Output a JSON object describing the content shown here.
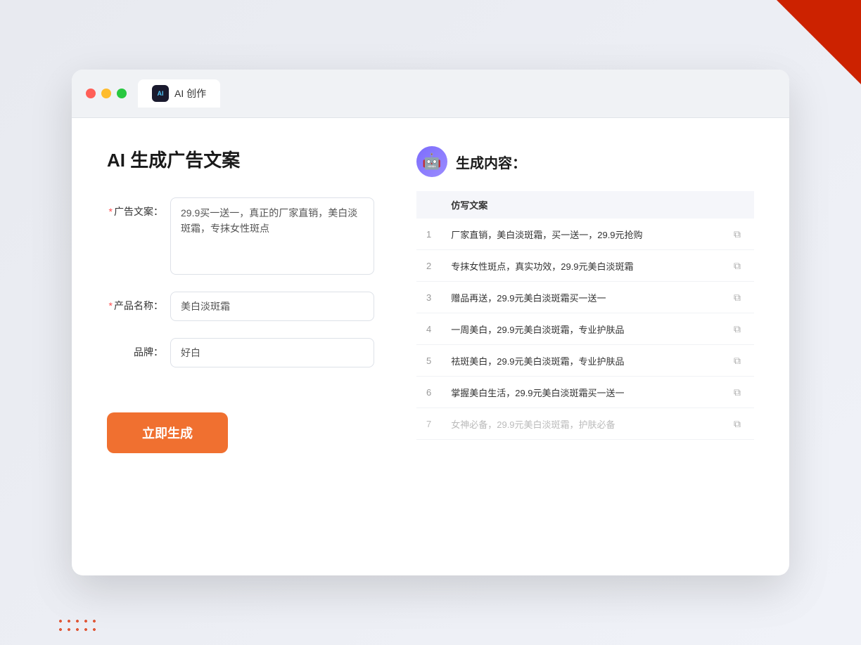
{
  "window": {
    "tab_label": "AI 创作",
    "controls": {
      "close": "close",
      "minimize": "minimize",
      "maximize": "maximize"
    }
  },
  "page": {
    "title": "AI 生成广告文案",
    "form": {
      "ad_copy_label": "广告文案：",
      "ad_copy_required": "*",
      "ad_copy_value": "29.9买一送一，真正的厂家直销，美白淡斑霜，专抹女性斑点",
      "product_name_label": "产品名称：",
      "product_name_required": "*",
      "product_name_value": "美白淡斑霜",
      "brand_label": "品牌：",
      "brand_value": "好白",
      "generate_button": "立即生成"
    },
    "result": {
      "header_title": "生成内容：",
      "column_header": "仿写文案",
      "items": [
        {
          "num": 1,
          "text": "厂家直销，美白淡斑霜，买一送一，29.9元抢购"
        },
        {
          "num": 2,
          "text": "专抹女性斑点，真实功效，29.9元美白淡斑霜"
        },
        {
          "num": 3,
          "text": "赠品再送，29.9元美白淡斑霜买一送一"
        },
        {
          "num": 4,
          "text": "一周美白，29.9元美白淡斑霜，专业护肤品"
        },
        {
          "num": 5,
          "text": "祛斑美白，29.9元美白淡斑霜，专业护肤品"
        },
        {
          "num": 6,
          "text": "掌握美白生活，29.9元美白淡斑霜买一送一"
        },
        {
          "num": 7,
          "text": "女神必备，29.9元美白淡斑霜，护肤必备",
          "faded": true
        }
      ]
    }
  }
}
